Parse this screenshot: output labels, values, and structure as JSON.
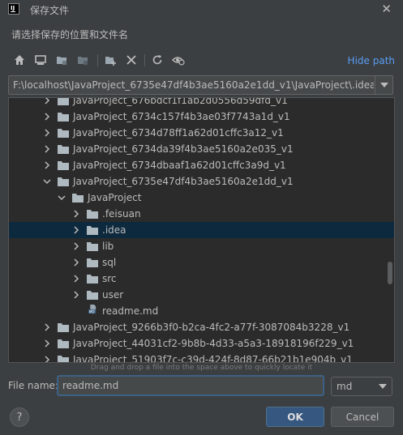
{
  "window": {
    "title": "保存文件",
    "close_glyph": "✕",
    "app_icon": "intellij-icon"
  },
  "subtitle": "请选择保存的位置和文件名",
  "toolbar": {
    "icons": [
      "home-icon",
      "desktop-icon",
      "project-folder-icon",
      "module-folder-icon",
      "new-folder-icon",
      "delete-icon",
      "refresh-icon",
      "show-hidden-icon"
    ],
    "hide_path": "Hide path"
  },
  "path": {
    "value": "F:\\localhost\\JavaProject_6735e47df4b3ae5160a2e1dd_v1\\JavaProject\\.idea"
  },
  "tree": {
    "rows": [
      {
        "label": "JavaProject_676bdcf1f1ab2d0556d59dfd_v1",
        "level": 2,
        "expanded": false,
        "icon": "folder"
      },
      {
        "label": "JavaProject_6734c157f4b3ae03f7743a1d_v1",
        "level": 2,
        "expanded": false,
        "icon": "folder"
      },
      {
        "label": "JavaProject_6734d78ff1a62d01cffc3a12_v1",
        "level": 2,
        "expanded": false,
        "icon": "folder"
      },
      {
        "label": "JavaProject_6734da39f4b3ae5160a2e035_v1",
        "level": 2,
        "expanded": false,
        "icon": "folder"
      },
      {
        "label": "JavaProject_6734dbaaf1a62d01cffc3a9d_v1",
        "level": 2,
        "expanded": false,
        "icon": "folder"
      },
      {
        "label": "JavaProject_6735e47df4b3ae5160a2e1dd_v1",
        "level": 2,
        "expanded": true,
        "icon": "folder"
      },
      {
        "label": "JavaProject",
        "level": 3,
        "expanded": true,
        "icon": "folder"
      },
      {
        "label": ".feisuan",
        "level": 4,
        "expanded": false,
        "icon": "folder"
      },
      {
        "label": ".idea",
        "level": 4,
        "expanded": false,
        "icon": "folder",
        "selected": true
      },
      {
        "label": "lib",
        "level": 4,
        "expanded": false,
        "icon": "folder"
      },
      {
        "label": "sql",
        "level": 4,
        "expanded": false,
        "icon": "folder"
      },
      {
        "label": "src",
        "level": 4,
        "expanded": false,
        "icon": "folder"
      },
      {
        "label": "user",
        "level": 4,
        "expanded": false,
        "icon": "folder"
      },
      {
        "label": "readme.md",
        "level": 4,
        "expanded": null,
        "icon": "md-file"
      },
      {
        "label": "JavaProject_9266b3f0-b2ca-4fc2-a77f-3087084b3228_v1",
        "level": 2,
        "expanded": false,
        "icon": "folder"
      },
      {
        "label": "JavaProject_44031cf2-9b8b-4d33-a5a3-18918196f229_v1",
        "level": 2,
        "expanded": false,
        "icon": "folder"
      },
      {
        "label": "JavaProject_51903f7c-c39d-424f-8d87-66b21b1e904b_v1",
        "level": 2,
        "expanded": false,
        "icon": "folder"
      }
    ],
    "md_badge": "MD"
  },
  "dnd_hint": "Drag and drop a file into the space above to quickly locate it",
  "filename": {
    "label": "File name:",
    "value": "readme.md"
  },
  "extension": {
    "value": "md"
  },
  "buttons": {
    "help": "?",
    "ok": "OK",
    "cancel": "Cancel"
  },
  "colors": {
    "background": "#3c3f41",
    "tree_bg": "#2b2b2b",
    "selection": "#0d293e",
    "link": "#589df6",
    "primary_button": "#365880",
    "folder": "#aeb9c0"
  }
}
